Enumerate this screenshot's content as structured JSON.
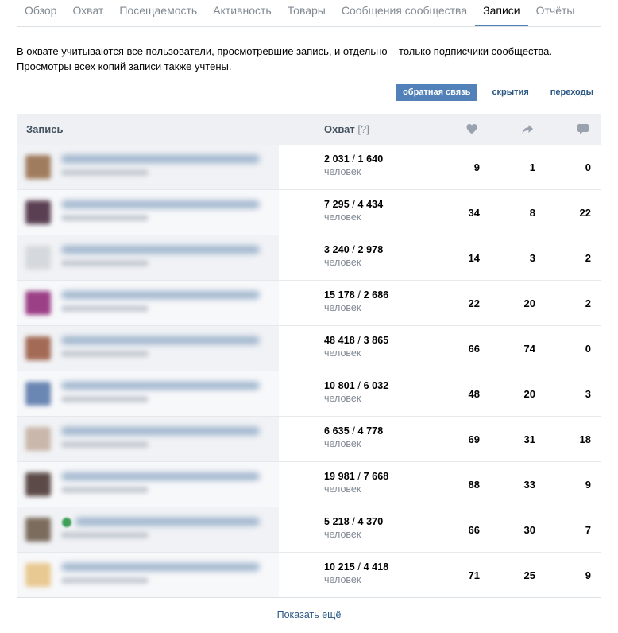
{
  "tabs": [
    {
      "label": "Обзор",
      "active": false
    },
    {
      "label": "Охват",
      "active": false
    },
    {
      "label": "Посещаемость",
      "active": false
    },
    {
      "label": "Активность",
      "active": false
    },
    {
      "label": "Товары",
      "active": false
    },
    {
      "label": "Сообщения сообщества",
      "active": false
    },
    {
      "label": "Записи",
      "active": true
    },
    {
      "label": "Отчёты",
      "active": false
    }
  ],
  "info": {
    "line1": "В охвате учитываются все пользователи, просмотревшие запись, и отдельно – только подписчики сообщества.",
    "line2": "Просмотры всех копий записи также учтены."
  },
  "segments": {
    "feedback": "обратная связь",
    "hides": "скрытия",
    "clicks": "переходы"
  },
  "table": {
    "col_post": "Запись",
    "col_reach": "Охват",
    "col_reach_hint": "[?]",
    "icons": {
      "likes": "heart-icon",
      "shares": "share-arrow-icon",
      "comments": "comment-bubble-icon"
    },
    "unit": "человек",
    "rows": [
      {
        "reach_total": "2 031",
        "reach_subs": "1 640",
        "likes": "9",
        "shares": "1",
        "comments": "0",
        "thumb": "#a07c5e"
      },
      {
        "reach_total": "7 295",
        "reach_subs": "4 434",
        "likes": "34",
        "shares": "8",
        "comments": "22",
        "thumb": "#5a3f52"
      },
      {
        "reach_total": "3 240",
        "reach_subs": "2 978",
        "likes": "14",
        "shares": "3",
        "comments": "2",
        "thumb": "#d5d8dc"
      },
      {
        "reach_total": "15 178",
        "reach_subs": "2 686",
        "likes": "22",
        "shares": "20",
        "comments": "2",
        "thumb": "#9b3f86"
      },
      {
        "reach_total": "48 418",
        "reach_subs": "3 865",
        "likes": "66",
        "shares": "74",
        "comments": "0",
        "thumb": "#a36a55"
      },
      {
        "reach_total": "10 801",
        "reach_subs": "6 032",
        "likes": "48",
        "shares": "20",
        "comments": "3",
        "thumb": "#6a86b2"
      },
      {
        "reach_total": "6 635",
        "reach_subs": "4 778",
        "likes": "69",
        "shares": "31",
        "comments": "18",
        "thumb": "#c9b7ab"
      },
      {
        "reach_total": "19 981",
        "reach_subs": "7 668",
        "likes": "88",
        "shares": "33",
        "comments": "9",
        "thumb": "#5b4a47"
      },
      {
        "reach_total": "5 218",
        "reach_subs": "4 370",
        "likes": "66",
        "shares": "30",
        "comments": "7",
        "thumb": "#7b6c5e",
        "dot": true
      },
      {
        "reach_total": "10 215",
        "reach_subs": "4 418",
        "likes": "71",
        "shares": "25",
        "comments": "9",
        "thumb": "#e8c991"
      }
    ]
  },
  "show_more": "Показать ещё",
  "colors": {
    "accent": "#5181b8",
    "link": "#2a5885",
    "header_bg": "#eef0f3",
    "muted": "#828a93"
  }
}
